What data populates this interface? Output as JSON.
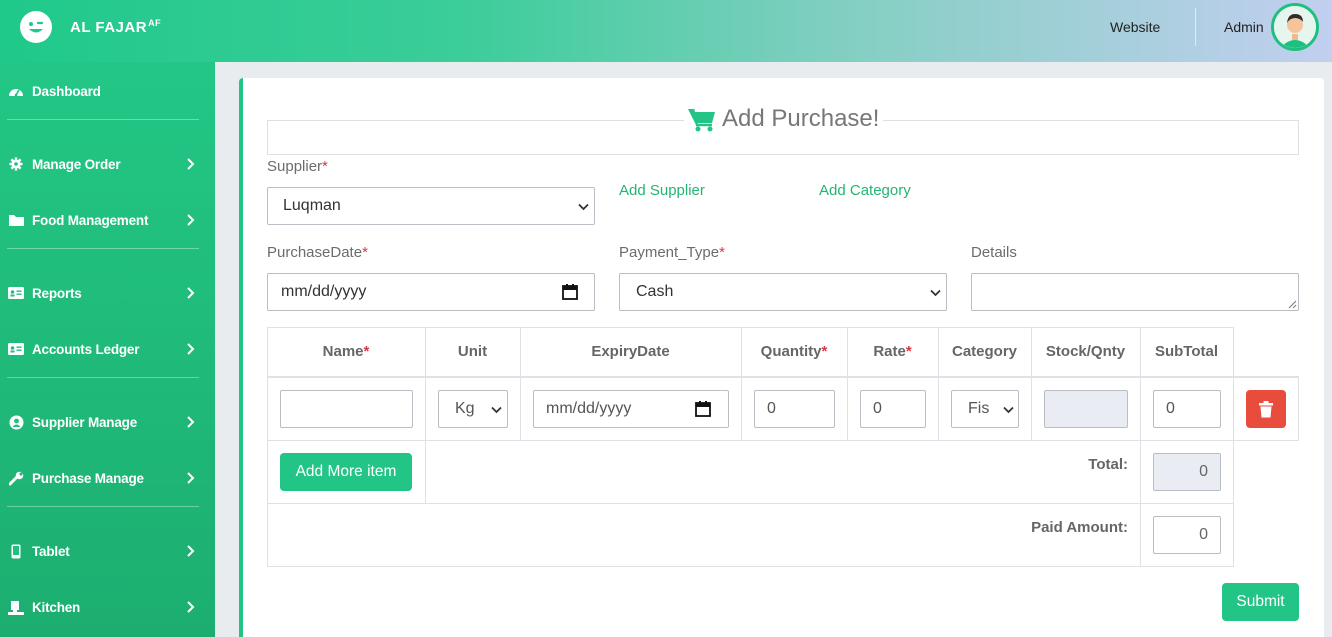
{
  "brand": {
    "name": "AL FAJAR",
    "sup": "AF"
  },
  "topbar": {
    "website_link": "Website",
    "admin_link": "Admin"
  },
  "sidebar": {
    "items": [
      {
        "label": "Dashboard",
        "icon": "dashboard-icon"
      },
      {
        "label": "Manage Order",
        "icon": "gear-icon"
      },
      {
        "label": "Food Management",
        "icon": "folder-icon"
      },
      {
        "label": "Reports",
        "icon": "id-card-icon"
      },
      {
        "label": "Accounts Ledger",
        "icon": "id-card-icon"
      },
      {
        "label": "Supplier Manage",
        "icon": "user-circle-icon"
      },
      {
        "label": "Purchase Manage",
        "icon": "wrench-icon"
      },
      {
        "label": "Tablet",
        "icon": "mobile-icon"
      },
      {
        "label": "Kitchen",
        "icon": "chef-icon"
      }
    ]
  },
  "form": {
    "title": "Add Purchase!",
    "supplier_label": "Supplier",
    "supplier_value": "Luqman",
    "add_supplier": "Add Supplier",
    "add_category": "Add Category",
    "purchase_date_label": "PurchaseDate",
    "purchase_date_placeholder": "mm/dd/yyyy",
    "payment_type_label": "Payment_Type",
    "payment_type_value": "Cash",
    "details_label": "Details",
    "required_mark": "*"
  },
  "table": {
    "headers": {
      "name": "Name",
      "unit": "Unit",
      "expiry": "ExpiryDate",
      "quantity": "Quantity",
      "rate": "Rate",
      "category": "Category",
      "stock": "Stock/Qnty",
      "subtotal": "SubTotal"
    },
    "row": {
      "name": "",
      "unit": "Kg",
      "expiry_placeholder": "mm/dd/yyyy",
      "quantity": "0",
      "rate": "0",
      "category": "Fis",
      "stock": "",
      "subtotal": "0"
    },
    "add_more_label": "Add More item",
    "total_label": "Total:",
    "total_value": "0",
    "paid_label": "Paid Amount:",
    "paid_value": "0"
  },
  "submit_label": "Submit",
  "colors": {
    "accent": "#22c585",
    "danger": "#e74c3c",
    "required": "#dc3545"
  }
}
